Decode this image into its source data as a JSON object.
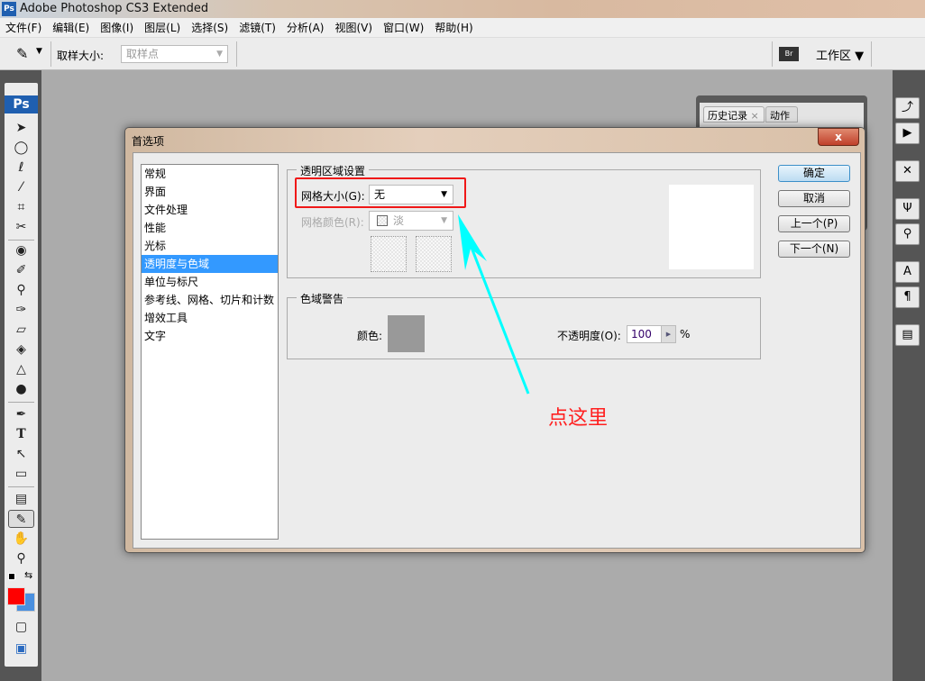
{
  "app": {
    "title": "Adobe Photoshop CS3 Extended",
    "logo": "Ps"
  },
  "menu": [
    "文件(F)",
    "编辑(E)",
    "图像(I)",
    "图层(L)",
    "选择(S)",
    "滤镜(T)",
    "分析(A)",
    "视图(V)",
    "窗口(W)",
    "帮助(H)"
  ],
  "options": {
    "sample_label": "取样大小:",
    "sample_value": "取样点",
    "workspace": "工作区 ▼",
    "bridge": "Br"
  },
  "history_panel": {
    "tabs": [
      "历史记录",
      "动作"
    ]
  },
  "dialog": {
    "title": "首选项",
    "close": "x",
    "categories": [
      "常规",
      "界面",
      "文件处理",
      "性能",
      "光标",
      "透明度与色域",
      "单位与标尺",
      "参考线、网格、切片和计数",
      "增效工具",
      "文字"
    ],
    "selected_index": 5,
    "transparency": {
      "legend": "透明区域设置",
      "grid_size_label": "网格大小(G):",
      "grid_size_value": "无",
      "grid_color_label": "网格颜色(R):",
      "grid_color_value": "淡"
    },
    "gamut": {
      "legend": "色域警告",
      "color_label": "颜色:",
      "opacity_label": "不透明度(O):",
      "opacity_value": "100",
      "opacity_unit": "%",
      "color": "#999999"
    },
    "buttons": {
      "ok": "确定",
      "cancel": "取消",
      "prev": "上一个(P)",
      "next": "下一个(N)"
    }
  },
  "annotation": {
    "text": "点这里",
    "color": "#ff2020",
    "arrow_color": "#00ffff"
  },
  "colors": {
    "foreground": "#ff0000",
    "background": "#4a90e0"
  }
}
